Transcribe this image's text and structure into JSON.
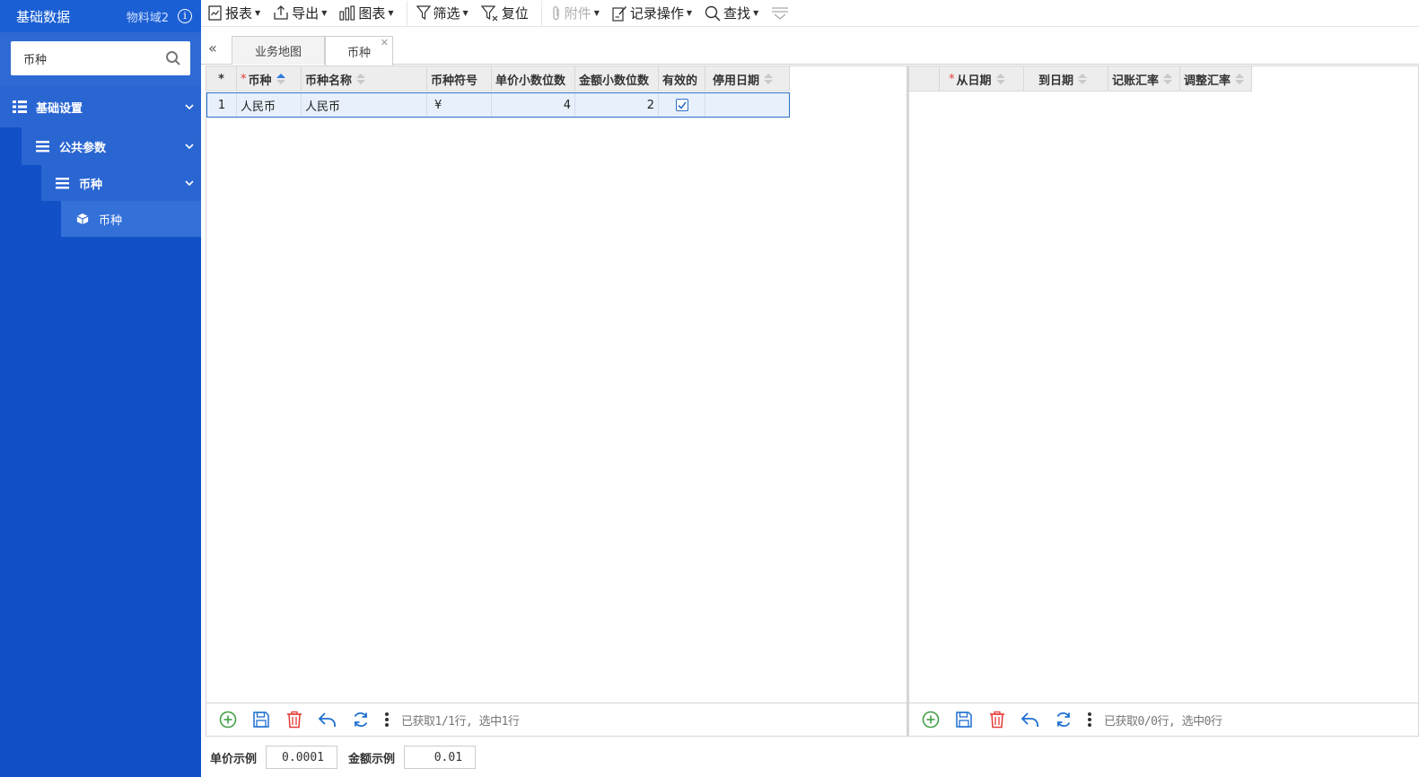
{
  "sidebar": {
    "title": "基础数据",
    "domain": "物料域2",
    "info_icon": "info-icon",
    "search": {
      "value": "币种"
    },
    "nav": [
      {
        "label": "基础设置",
        "icon": "grid-list-icon",
        "level": 1,
        "expanded": true
      },
      {
        "label": "公共参数",
        "icon": "menu-icon",
        "level": 2,
        "expanded": true
      },
      {
        "label": "币种",
        "icon": "menu-icon",
        "level": 3,
        "expanded": true
      },
      {
        "label": "币种",
        "icon": "cube-icon",
        "level": 4
      }
    ],
    "colors": {
      "background": "#1150c6",
      "header": "#1b5fd4"
    }
  },
  "toolbar": {
    "report": "报表",
    "export": "导出",
    "chart": "图表",
    "filter": "筛选",
    "reset": "复位",
    "attachment": "附件",
    "record_ops": "记录操作",
    "find": "查找"
  },
  "tabs": [
    {
      "label": "业务地图",
      "active": false
    },
    {
      "label": "币种",
      "active": true,
      "closable": true
    }
  ],
  "left_grid": {
    "columns": [
      "*",
      "币种",
      "币种名称",
      "币种符号",
      "单价小数位数",
      "金额小数位数",
      "有效的",
      "停用日期"
    ],
    "rows": [
      {
        "index": "1",
        "code": "人民币",
        "name": "人民币",
        "symbol": "¥",
        "price_decimals": "4",
        "amount_decimals": "2",
        "valid": true,
        "disable_date": ""
      }
    ],
    "status": "已获取1/1行, 选中1行"
  },
  "right_grid": {
    "columns": [
      "从日期",
      "到日期",
      "记账汇率",
      "调整汇率"
    ],
    "rows": [],
    "status": "已获取0/0行, 选中0行"
  },
  "bottom": {
    "price_example_label": "单价示例",
    "price_example_value": "0.0001",
    "amount_example_label": "金额示例",
    "amount_example_value": "0.01"
  }
}
